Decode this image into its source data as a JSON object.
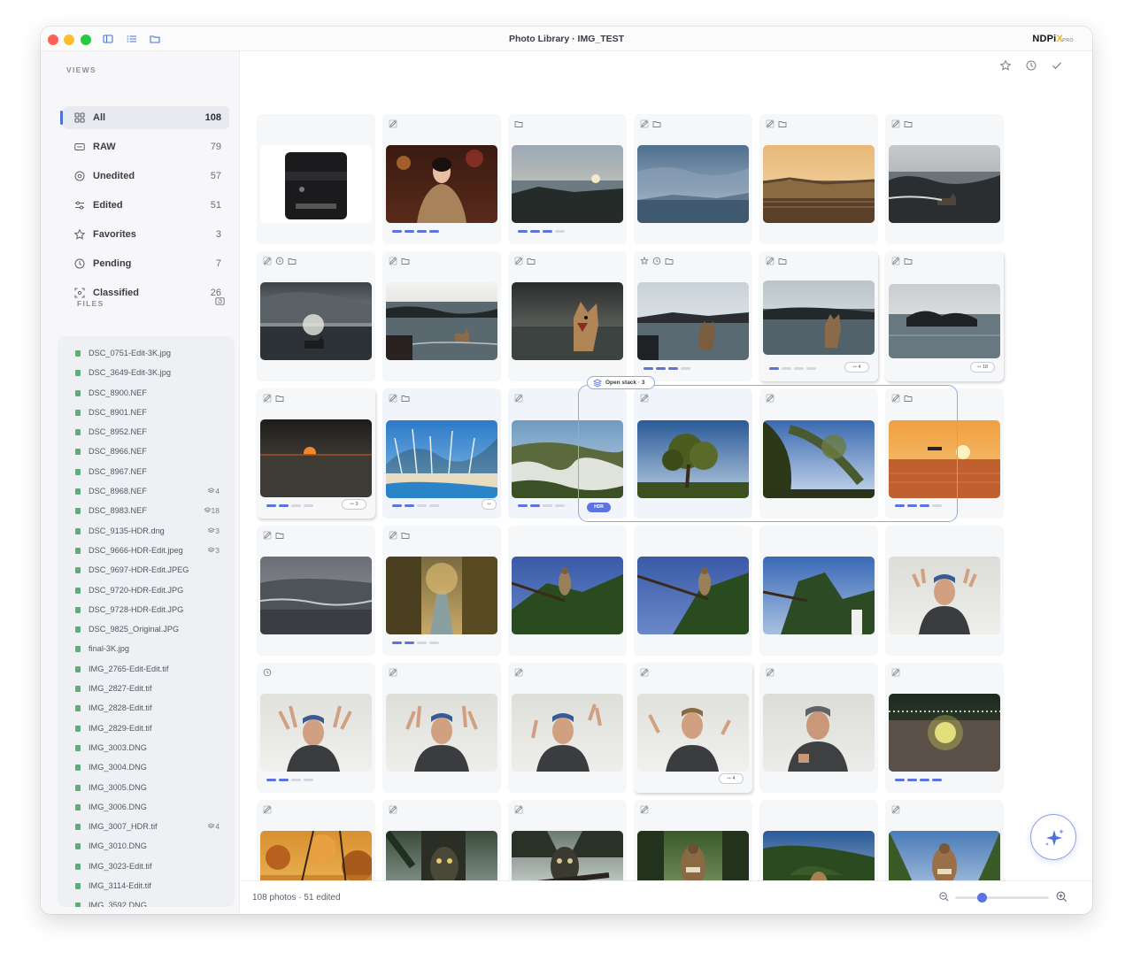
{
  "window": {
    "title": "Photo Library · IMG_TEST",
    "brand_main": "NDPi",
    "brand_accent": "X",
    "brand_tier": "PRO"
  },
  "sidebar": {
    "views_heading": "VIEWS",
    "files_heading": "FILES",
    "views": [
      {
        "label": "All",
        "count": "108",
        "icon": "grid-icon"
      },
      {
        "label": "RAW",
        "count": "79",
        "icon": "raw-icon"
      },
      {
        "label": "Unedited",
        "count": "57",
        "icon": "circle-dot-icon"
      },
      {
        "label": "Edited",
        "count": "51",
        "icon": "sliders-icon"
      },
      {
        "label": "Favorites",
        "count": "3",
        "icon": "star-icon"
      },
      {
        "label": "Pending",
        "count": "7",
        "icon": "clock-icon"
      },
      {
        "label": "Classified",
        "count": "26",
        "icon": "classified-icon"
      }
    ],
    "files": [
      {
        "name": "DSC_0751-Edit-3K.jpg",
        "count": ""
      },
      {
        "name": "DSC_3649-Edit-3K.jpg",
        "count": ""
      },
      {
        "name": "DSC_8900.NEF",
        "count": ""
      },
      {
        "name": "DSC_8901.NEF",
        "count": ""
      },
      {
        "name": "DSC_8952.NEF",
        "count": ""
      },
      {
        "name": "DSC_8966.NEF",
        "count": ""
      },
      {
        "name": "DSC_8967.NEF",
        "count": ""
      },
      {
        "name": "DSC_8968.NEF",
        "count": "4"
      },
      {
        "name": "DSC_8983.NEF",
        "count": "18"
      },
      {
        "name": "DSC_9135-HDR.dng",
        "count": "3"
      },
      {
        "name": "DSC_9666-HDR-Edit.jpeg",
        "count": "3"
      },
      {
        "name": "DSC_9697-HDR-Edit.JPEG",
        "count": ""
      },
      {
        "name": "DSC_9720-HDR-Edit.JPG",
        "count": ""
      },
      {
        "name": "DSC_9728-HDR-Edit.JPG",
        "count": ""
      },
      {
        "name": "DSC_9825_Original.JPG",
        "count": ""
      },
      {
        "name": "final-3K.jpg",
        "count": ""
      },
      {
        "name": "IMG_2765-Edit-Edit.tif",
        "count": ""
      },
      {
        "name": "IMG_2827-Edit.tif",
        "count": ""
      },
      {
        "name": "IMG_2828-Edit.tif",
        "count": ""
      },
      {
        "name": "IMG_2829-Edit.tif",
        "count": ""
      },
      {
        "name": "IMG_3003.DNG",
        "count": ""
      },
      {
        "name": "IMG_3004.DNG",
        "count": ""
      },
      {
        "name": "IMG_3005.DNG",
        "count": ""
      },
      {
        "name": "IMG_3006.DNG",
        "count": ""
      },
      {
        "name": "IMG_3007_HDR.tif",
        "count": "4"
      },
      {
        "name": "IMG_3010.DNG",
        "count": ""
      },
      {
        "name": "IMG_3023-Edit.tif",
        "count": ""
      },
      {
        "name": "IMG_3114-Edit.tif",
        "count": ""
      },
      {
        "name": "IMG_3592.DNG",
        "count": ""
      }
    ]
  },
  "stack": {
    "label": "Open stack · 3",
    "hdr_badge": "HDR"
  },
  "grid": {
    "rows": [
      [
        {
          "photo": "lens",
          "icons": [],
          "progress": 0,
          "stack": ""
        },
        {
          "photo": "portrait-night",
          "icons": [
            "edit"
          ],
          "progress": 4,
          "stack": ""
        },
        {
          "photo": "coast-sunset",
          "icons": [
            "folder"
          ],
          "progress": 3,
          "stack": ""
        },
        {
          "photo": "blue-sky-sea",
          "icons": [
            "edit",
            "folder"
          ],
          "progress": 0,
          "stack": ""
        },
        {
          "photo": "golden-sea",
          "icons": [
            "edit",
            "folder"
          ],
          "progress": 0,
          "stack": ""
        },
        {
          "photo": "rocks-dog",
          "icons": [
            "edit",
            "folder"
          ],
          "progress": 0,
          "stack": ""
        }
      ],
      [
        {
          "photo": "stormy-dog",
          "icons": [
            "edit",
            "clock",
            "folder"
          ],
          "progress": 0,
          "stack": ""
        },
        {
          "photo": "rocky-shore-dog",
          "icons": [
            "edit",
            "folder"
          ],
          "progress": 0,
          "stack": ""
        },
        {
          "photo": "dog-closeup",
          "icons": [
            "edit",
            "folder"
          ],
          "progress": 0,
          "stack": ""
        },
        {
          "photo": "dog-shore",
          "icons": [
            "star",
            "clock",
            "folder"
          ],
          "progress": 3,
          "stack": ""
        },
        {
          "photo": "dog-shore2",
          "icons": [
            "edit",
            "folder"
          ],
          "progress": 1,
          "stack": "4"
        },
        {
          "photo": "rock-sea",
          "icons": [
            "edit",
            "folder"
          ],
          "progress": 0,
          "stack": "18"
        }
      ],
      [
        {
          "photo": "dark-sunset",
          "icons": [
            "edit",
            "folder"
          ],
          "progress": 2,
          "stack": "3"
        },
        {
          "photo": "beach-trees",
          "icons": [
            "edit",
            "folder"
          ],
          "progress": 2,
          "stack": ""
        },
        {
          "photo": "rocky-hill",
          "icons": [
            "edit"
          ],
          "progress": 2,
          "stack": ""
        },
        {
          "photo": "oak-tree",
          "icons": [
            "edit"
          ],
          "progress": 0,
          "stack": ""
        },
        {
          "photo": "moss-tree",
          "icons": [
            "edit"
          ],
          "progress": 0,
          "stack": ""
        },
        {
          "photo": "orange-sunset",
          "icons": [
            "edit",
            "folder"
          ],
          "progress": 3,
          "stack": ""
        }
      ],
      [
        {
          "photo": "grey-sea",
          "icons": [
            "edit",
            "folder"
          ],
          "progress": 0,
          "stack": ""
        },
        {
          "photo": "canal-trees",
          "icons": [
            "edit",
            "folder"
          ],
          "progress": 2,
          "stack": ""
        },
        {
          "photo": "hawk-palm",
          "icons": [],
          "progress": 0,
          "stack": ""
        },
        {
          "photo": "hawk-palm2",
          "icons": [],
          "progress": 0,
          "stack": ""
        },
        {
          "photo": "palm-tree",
          "icons": [],
          "progress": 0,
          "stack": ""
        },
        {
          "photo": "man-hands",
          "icons": [],
          "progress": 0,
          "stack": ""
        }
      ],
      [
        {
          "photo": "man-hands2",
          "icons": [
            "clock"
          ],
          "progress": 2,
          "stack": ""
        },
        {
          "photo": "man-hands3",
          "icons": [
            "edit"
          ],
          "progress": 0,
          "stack": ""
        },
        {
          "photo": "man-hands4",
          "icons": [
            "edit"
          ],
          "progress": 0,
          "stack": ""
        },
        {
          "photo": "man-hands5",
          "icons": [
            "edit"
          ],
          "progress": 0,
          "stack": "4"
        },
        {
          "photo": "man-cap",
          "icons": [
            "edit"
          ],
          "progress": 0,
          "stack": ""
        },
        {
          "photo": "sparkler-road",
          "icons": [
            "edit"
          ],
          "progress": 4,
          "stack": ""
        }
      ],
      [
        {
          "photo": "autumn-leaves",
          "icons": [
            "edit"
          ],
          "progress": 0,
          "stack": ""
        },
        {
          "photo": "owl-tree",
          "icons": [
            "edit"
          ],
          "progress": 0,
          "stack": ""
        },
        {
          "photo": "owl-branch",
          "icons": [
            "edit"
          ],
          "progress": 0,
          "stack": ""
        },
        {
          "photo": "hawk-forest",
          "icons": [
            "edit"
          ],
          "progress": 0,
          "stack": ""
        },
        {
          "photo": "hawk-forest2",
          "icons": [],
          "progress": 0,
          "stack": ""
        },
        {
          "photo": "hawk-forest3",
          "icons": [
            "edit"
          ],
          "progress": 0,
          "stack": ""
        }
      ]
    ]
  },
  "status_bar": {
    "text": "108 photos · 51 edited",
    "zoom": 0.3
  },
  "colors": {
    "accent": "#4b72d8",
    "progress_active": "#5b74e0",
    "progress_idle": "#d4d7e0"
  }
}
